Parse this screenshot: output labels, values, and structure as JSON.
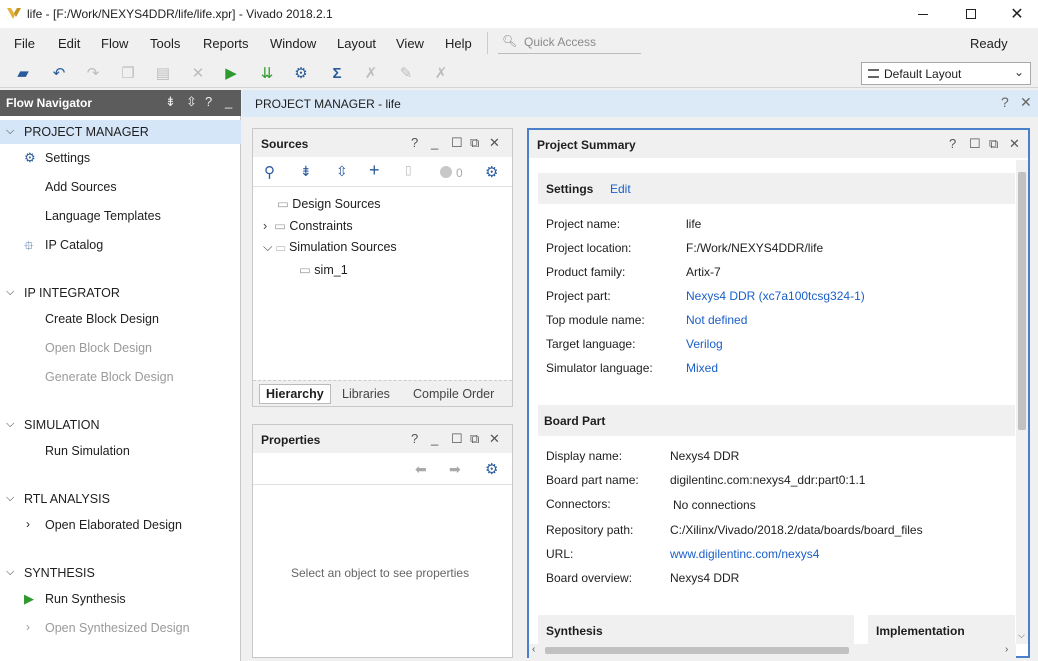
{
  "window": {
    "title": "life - [F:/Work/NEXYS4DDR/life/life.xpr] - Vivado 2018.2.1",
    "min": "—",
    "max": "☐",
    "close": "✕"
  },
  "menu": {
    "items": [
      "File",
      "Edit",
      "Flow",
      "Tools",
      "Reports",
      "Window",
      "Layout",
      "View",
      "Help"
    ],
    "quick_access": "Quick Access",
    "status": "Ready"
  },
  "toolbar": {
    "layout_select": "Default Layout"
  },
  "flow_nav": {
    "title": "Flow Navigator",
    "sections": [
      {
        "label": "PROJECT MANAGER",
        "items": [
          {
            "label": "Settings",
            "icon": "gear-icon"
          },
          {
            "label": "Add Sources"
          },
          {
            "label": "Language Templates"
          },
          {
            "label": "IP Catalog",
            "icon": "plug-icon"
          }
        ]
      },
      {
        "label": "IP INTEGRATOR",
        "items": [
          {
            "label": "Create Block Design"
          },
          {
            "label": "Open Block Design"
          },
          {
            "label": "Generate Block Design"
          }
        ]
      },
      {
        "label": "SIMULATION",
        "items": [
          {
            "label": "Run Simulation"
          }
        ]
      },
      {
        "label": "RTL ANALYSIS",
        "items": [
          {
            "label": "Open Elaborated Design"
          }
        ]
      },
      {
        "label": "SYNTHESIS",
        "items": [
          {
            "label": "Run Synthesis"
          },
          {
            "label": "Open Synthesized Design"
          }
        ]
      }
    ]
  },
  "pm_header": {
    "title": "PROJECT MANAGER",
    "sep": " - ",
    "project": "life"
  },
  "sources": {
    "title": "Sources",
    "count": "0",
    "tree": [
      "Design Sources",
      "Constraints",
      "Simulation Sources",
      "sim_1"
    ],
    "tabs": [
      "Hierarchy",
      "Libraries",
      "Compile Order"
    ]
  },
  "properties": {
    "title": "Properties",
    "empty_text": "Select an object to see properties"
  },
  "summary": {
    "title": "Project Summary",
    "settings": {
      "label": "Settings",
      "edit": "Edit",
      "rows": [
        {
          "k": "Project name:",
          "v": "life"
        },
        {
          "k": "Project location:",
          "v": "F:/Work/NEXYS4DDR/life"
        },
        {
          "k": "Product family:",
          "v": "Artix-7"
        },
        {
          "k": "Project part:",
          "v": "Nexys4 DDR (xc7a100tcsg324-1)"
        },
        {
          "k": "Top module name:",
          "v": "Not defined"
        },
        {
          "k": "Target language:",
          "v": "Verilog"
        },
        {
          "k": "Simulator language:",
          "v": "Mixed"
        }
      ]
    },
    "board": {
      "label": "Board Part",
      "rows": [
        {
          "k": "Display name:",
          "v": "Nexys4 DDR"
        },
        {
          "k": "Board part name:",
          "v": "digilentinc.com:nexys4_ddr:part0:1.1"
        },
        {
          "k": "Connectors:",
          "v": "No connections"
        },
        {
          "k": "Repository path:",
          "v": "C:/Xilinx/Vivado/2018.2/data/boards/board_files"
        },
        {
          "k": "URL:",
          "v": "www.digilentinc.com/nexys4"
        },
        {
          "k": "Board overview:",
          "v": "Nexys4 DDR"
        }
      ]
    },
    "synthesis": "Synthesis",
    "implementation": "Implementation"
  },
  "colors": {
    "accent": "#1a5fc8",
    "selected": "#d5e6f8",
    "nav_header": "#5c5c5c",
    "run_green": "#2e9a2e"
  }
}
